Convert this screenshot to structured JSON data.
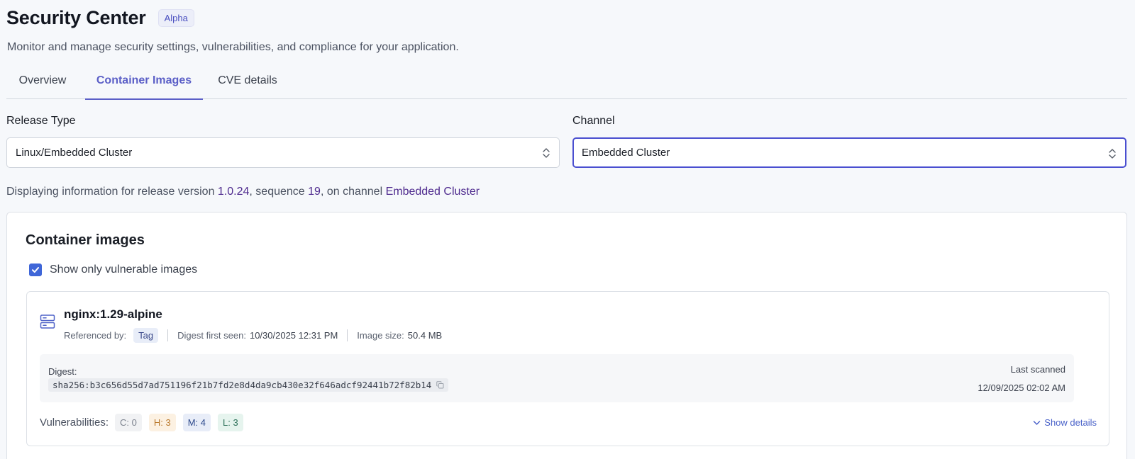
{
  "header": {
    "title": "Security Center",
    "badge": "Alpha",
    "subtitle": "Monitor and manage security settings, vulnerabilities, and compliance for your application."
  },
  "tabs": [
    {
      "label": "Overview",
      "active": false
    },
    {
      "label": "Container Images",
      "active": true
    },
    {
      "label": "CVE details",
      "active": false
    }
  ],
  "filters": {
    "release_type_label": "Release Type",
    "release_type_value": "Linux/Embedded Cluster",
    "channel_label": "Channel",
    "channel_value": "Embedded Cluster"
  },
  "info": {
    "prefix": "Displaying information for release version ",
    "version": "1.0.24",
    "mid1": ", sequence ",
    "sequence": "19",
    "mid2": ", on channel ",
    "channel": "Embedded Cluster"
  },
  "card": {
    "title": "Container images",
    "checkbox_label": "Show only vulnerable images",
    "checkbox_checked": true
  },
  "image": {
    "name": "nginx:1.29-alpine",
    "referenced_by_label": "Referenced by:",
    "referenced_by_value": "Tag",
    "digest_first_seen_label": "Digest first seen:",
    "digest_first_seen_value": "10/30/2025 12:31 PM",
    "image_size_label": "Image size:",
    "image_size_value": "50.4 MB",
    "digest_label": "Digest:",
    "digest_value": "sha256:b3c656d55d7ad751196f21b7fd2e8d4da9cb430e32f646adcf92441b72f82b14",
    "last_scanned_label": "Last scanned",
    "last_scanned_value": "12/09/2025 02:02 AM",
    "vulnerabilities_label": "Vulnerabilities:",
    "vuln": {
      "critical": "C: 0",
      "high": "H: 3",
      "medium": "M: 4",
      "low": "L: 3"
    },
    "show_details_label": "Show details"
  },
  "colors": {
    "accent": "#5b5fc7",
    "checkbox": "#3f66d8",
    "link": "#4a62c9",
    "highlight_text": "#4e2a8e"
  },
  "icons": [
    "sort-icon",
    "check-icon",
    "server-icon",
    "copy-icon",
    "chevron-down-icon"
  ]
}
